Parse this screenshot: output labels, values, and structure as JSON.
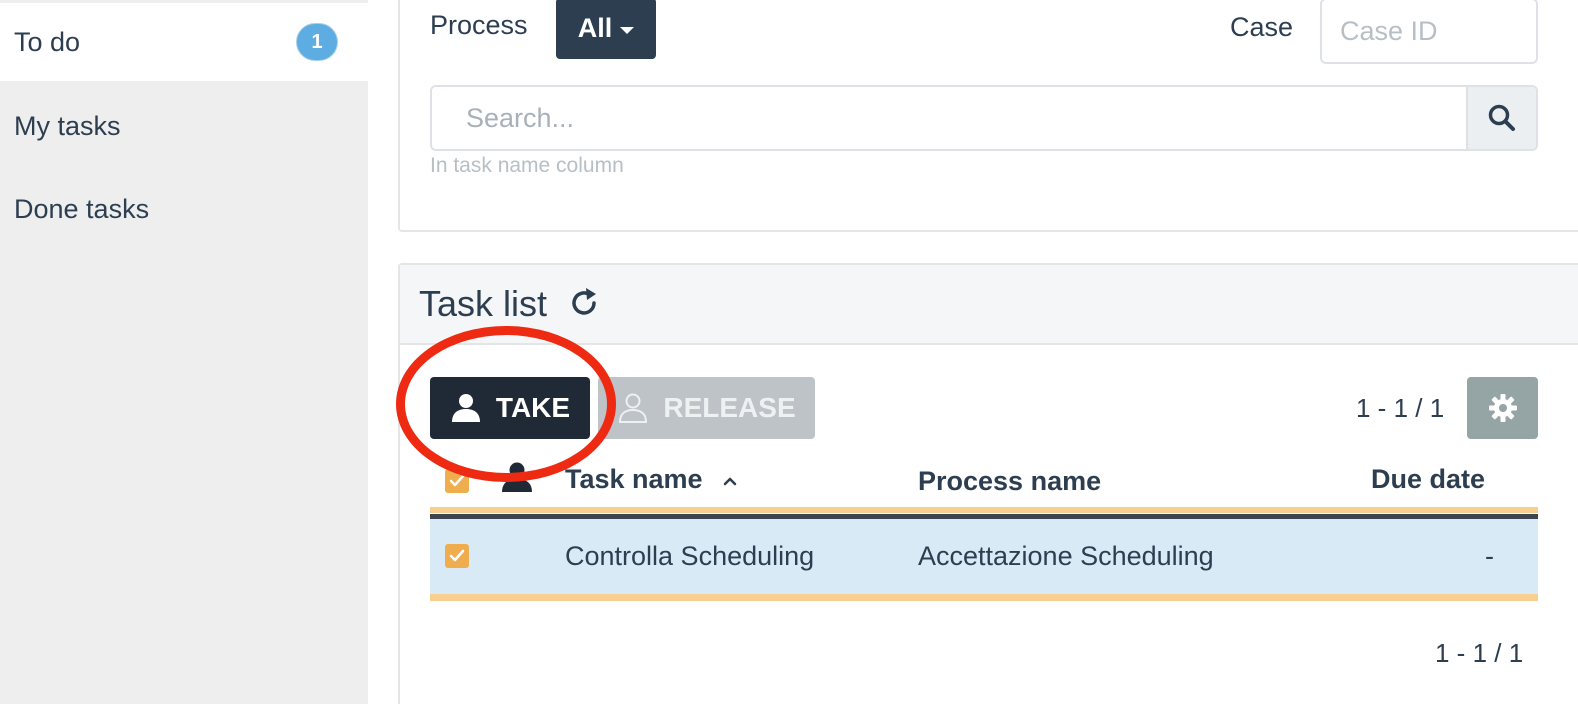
{
  "sidebar": {
    "items": [
      {
        "label": "To do",
        "badge": "1",
        "active": true
      },
      {
        "label": "My tasks"
      },
      {
        "label": "Done tasks"
      }
    ]
  },
  "filters": {
    "process_label": "Process",
    "process_value": "All",
    "case_label": "Case",
    "case_placeholder": "Case ID",
    "search_placeholder": "Search...",
    "search_hint": "In task name column"
  },
  "task_list": {
    "title": "Task list",
    "take_label": "TAKE",
    "release_label": "RELEASE",
    "pagination_top": "1 - 1 / 1",
    "pagination_bottom": "1 - 1 / 1",
    "columns": {
      "task": "Task name",
      "process": "Process name",
      "due": "Due date"
    },
    "rows": [
      {
        "task": "Controlla Scheduling",
        "process": "Accettazione Scheduling",
        "due": "-",
        "selected": true
      }
    ]
  },
  "colors": {
    "primary_dark": "#2c3e50",
    "badge_blue": "#5dade2",
    "checkbox_orange": "#f0ad4e",
    "selected_row": "#d9eaf7",
    "annotation_red": "#ee2a12"
  }
}
